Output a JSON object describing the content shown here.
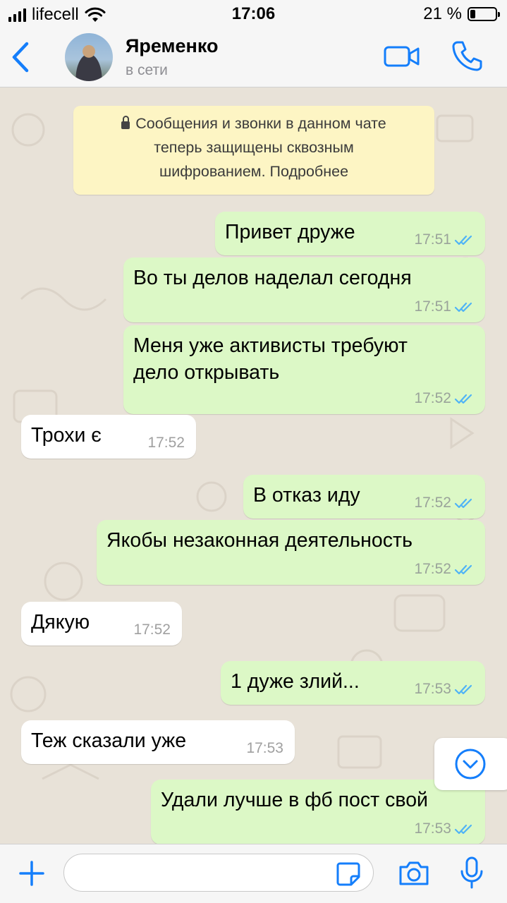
{
  "status_bar": {
    "carrier": "lifecell",
    "time": "17:06",
    "battery": "21 %",
    "battery_level": 0.21
  },
  "header": {
    "contact_name": "Яременко",
    "contact_status": "в сети",
    "accent_color": "#147efb"
  },
  "encryption_notice": {
    "line1": "Сообщения и звонки в данном чате",
    "line2": "теперь защищены сквозным",
    "line3": "шифрованием. Подробнее"
  },
  "messages": [
    {
      "direction": "out",
      "lines": [
        "Привет друже"
      ],
      "time": "17:51",
      "read": true
    },
    {
      "direction": "out",
      "lines": [
        "Во ты делов наделал сегодня"
      ],
      "time": "17:51",
      "read": true
    },
    {
      "direction": "out",
      "lines": [
        "Меня уже активисты требуют",
        "дело открывать"
      ],
      "time": "17:52",
      "read": true
    },
    {
      "direction": "in",
      "lines": [
        "Трохи є"
      ],
      "time": "17:52"
    },
    {
      "direction": "out",
      "lines": [
        "В отказ иду"
      ],
      "time": "17:52",
      "read": true
    },
    {
      "direction": "out",
      "lines": [
        "Якобы незаконная деятельность"
      ],
      "time": "17:52",
      "read": true
    },
    {
      "direction": "in",
      "lines": [
        "Дякую"
      ],
      "time": "17:52"
    },
    {
      "direction": "out",
      "lines": [
        "1 дуже злий..."
      ],
      "time": "17:53",
      "read": true
    },
    {
      "direction": "in",
      "lines": [
        "Теж сказали уже"
      ],
      "time": "17:53"
    },
    {
      "direction": "out",
      "lines": [
        "Удали лучше в фб пост свой"
      ],
      "time": "17:53",
      "read": true
    }
  ],
  "colors": {
    "outgoing_bubble": "#dcf8c6",
    "incoming_bubble": "#ffffff",
    "encryption_bubble": "#fdf5c4",
    "read_ticks": "#4fb3f6",
    "chat_background": "#e8e2d8"
  },
  "input_bar": {
    "placeholder": "",
    "icons": [
      "plus-icon",
      "sticker-icon",
      "camera-icon",
      "microphone-icon"
    ]
  },
  "scroll_down_icon": "chevron-down-circle-icon"
}
